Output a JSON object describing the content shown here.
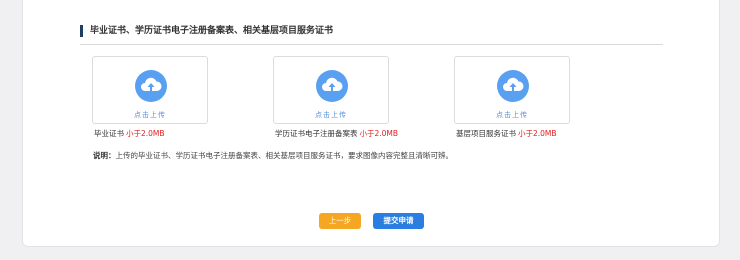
{
  "section": {
    "title": "毕业证书、学历证书电子注册备案表、相关基层项目服务证书"
  },
  "uploads": [
    {
      "button_text": "点击上传",
      "caption": "毕业证书",
      "limit": "小于2.0MB"
    },
    {
      "button_text": "点击上传",
      "caption": "学历证书电子注册备案表",
      "limit": "小于2.0MB"
    },
    {
      "button_text": "点击上传",
      "caption": "基层项目服务证书",
      "limit": "小于2.0MB"
    }
  ],
  "note": {
    "label": "说明：",
    "text": "上传的毕业证书、学历证书电子注册备案表、相关基层项目服务证书，要求图像内容完整且清晰可辨。"
  },
  "buttons": {
    "prev": "上一步",
    "submit": "提交申请"
  },
  "colors": {
    "accent_blue": "#2a7de1",
    "icon_blue": "#5aa0f0",
    "warning_orange": "#f5a623",
    "limit_red": "#e02020"
  }
}
